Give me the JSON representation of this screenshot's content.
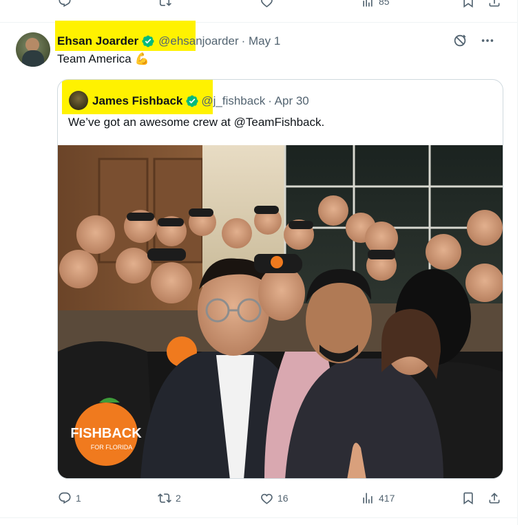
{
  "prev_tweet_actions": {
    "views": "85"
  },
  "tweet": {
    "author_name": "Ehsan Joarder",
    "handle": "@ehsanjoarder",
    "date": "· May 1",
    "text": "Team America",
    "emoji": "💪",
    "actions": {
      "replies": "1",
      "reposts": "2",
      "likes": "16",
      "views": "417"
    }
  },
  "quote": {
    "author_name": "James Fishback",
    "handle": "@j_fishback",
    "date": "· Apr 30",
    "text": "We’ve got an awesome crew at @TeamFishback.",
    "photo_shirt_text": "FISHBACK",
    "photo_shirt_subtext": "FOR FLORIDA"
  },
  "colors": {
    "verified": "#00ba7c",
    "highlight": "#fff200",
    "muted": "#536471",
    "border": "#cfd9de"
  },
  "icons": [
    "reply-icon",
    "repost-icon",
    "like-icon",
    "views-icon",
    "bookmark-icon",
    "share-icon",
    "grok-icon",
    "more-icon",
    "verified-badge-icon"
  ]
}
